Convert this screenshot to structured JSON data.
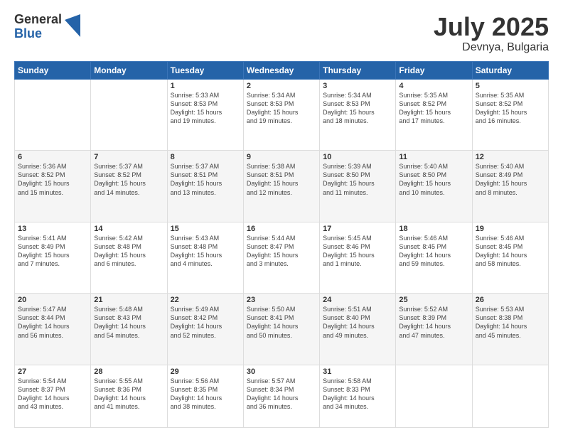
{
  "logo": {
    "general": "General",
    "blue": "Blue"
  },
  "title": "July 2025",
  "location": "Devnya, Bulgaria",
  "weekdays": [
    "Sunday",
    "Monday",
    "Tuesday",
    "Wednesday",
    "Thursday",
    "Friday",
    "Saturday"
  ],
  "weeks": [
    [
      {
        "day": "",
        "info": ""
      },
      {
        "day": "",
        "info": ""
      },
      {
        "day": "1",
        "info": "Sunrise: 5:33 AM\nSunset: 8:53 PM\nDaylight: 15 hours\nand 19 minutes."
      },
      {
        "day": "2",
        "info": "Sunrise: 5:34 AM\nSunset: 8:53 PM\nDaylight: 15 hours\nand 19 minutes."
      },
      {
        "day": "3",
        "info": "Sunrise: 5:34 AM\nSunset: 8:53 PM\nDaylight: 15 hours\nand 18 minutes."
      },
      {
        "day": "4",
        "info": "Sunrise: 5:35 AM\nSunset: 8:52 PM\nDaylight: 15 hours\nand 17 minutes."
      },
      {
        "day": "5",
        "info": "Sunrise: 5:35 AM\nSunset: 8:52 PM\nDaylight: 15 hours\nand 16 minutes."
      }
    ],
    [
      {
        "day": "6",
        "info": "Sunrise: 5:36 AM\nSunset: 8:52 PM\nDaylight: 15 hours\nand 15 minutes."
      },
      {
        "day": "7",
        "info": "Sunrise: 5:37 AM\nSunset: 8:52 PM\nDaylight: 15 hours\nand 14 minutes."
      },
      {
        "day": "8",
        "info": "Sunrise: 5:37 AM\nSunset: 8:51 PM\nDaylight: 15 hours\nand 13 minutes."
      },
      {
        "day": "9",
        "info": "Sunrise: 5:38 AM\nSunset: 8:51 PM\nDaylight: 15 hours\nand 12 minutes."
      },
      {
        "day": "10",
        "info": "Sunrise: 5:39 AM\nSunset: 8:50 PM\nDaylight: 15 hours\nand 11 minutes."
      },
      {
        "day": "11",
        "info": "Sunrise: 5:40 AM\nSunset: 8:50 PM\nDaylight: 15 hours\nand 10 minutes."
      },
      {
        "day": "12",
        "info": "Sunrise: 5:40 AM\nSunset: 8:49 PM\nDaylight: 15 hours\nand 8 minutes."
      }
    ],
    [
      {
        "day": "13",
        "info": "Sunrise: 5:41 AM\nSunset: 8:49 PM\nDaylight: 15 hours\nand 7 minutes."
      },
      {
        "day": "14",
        "info": "Sunrise: 5:42 AM\nSunset: 8:48 PM\nDaylight: 15 hours\nand 6 minutes."
      },
      {
        "day": "15",
        "info": "Sunrise: 5:43 AM\nSunset: 8:48 PM\nDaylight: 15 hours\nand 4 minutes."
      },
      {
        "day": "16",
        "info": "Sunrise: 5:44 AM\nSunset: 8:47 PM\nDaylight: 15 hours\nand 3 minutes."
      },
      {
        "day": "17",
        "info": "Sunrise: 5:45 AM\nSunset: 8:46 PM\nDaylight: 15 hours\nand 1 minute."
      },
      {
        "day": "18",
        "info": "Sunrise: 5:46 AM\nSunset: 8:45 PM\nDaylight: 14 hours\nand 59 minutes."
      },
      {
        "day": "19",
        "info": "Sunrise: 5:46 AM\nSunset: 8:45 PM\nDaylight: 14 hours\nand 58 minutes."
      }
    ],
    [
      {
        "day": "20",
        "info": "Sunrise: 5:47 AM\nSunset: 8:44 PM\nDaylight: 14 hours\nand 56 minutes."
      },
      {
        "day": "21",
        "info": "Sunrise: 5:48 AM\nSunset: 8:43 PM\nDaylight: 14 hours\nand 54 minutes."
      },
      {
        "day": "22",
        "info": "Sunrise: 5:49 AM\nSunset: 8:42 PM\nDaylight: 14 hours\nand 52 minutes."
      },
      {
        "day": "23",
        "info": "Sunrise: 5:50 AM\nSunset: 8:41 PM\nDaylight: 14 hours\nand 50 minutes."
      },
      {
        "day": "24",
        "info": "Sunrise: 5:51 AM\nSunset: 8:40 PM\nDaylight: 14 hours\nand 49 minutes."
      },
      {
        "day": "25",
        "info": "Sunrise: 5:52 AM\nSunset: 8:39 PM\nDaylight: 14 hours\nand 47 minutes."
      },
      {
        "day": "26",
        "info": "Sunrise: 5:53 AM\nSunset: 8:38 PM\nDaylight: 14 hours\nand 45 minutes."
      }
    ],
    [
      {
        "day": "27",
        "info": "Sunrise: 5:54 AM\nSunset: 8:37 PM\nDaylight: 14 hours\nand 43 minutes."
      },
      {
        "day": "28",
        "info": "Sunrise: 5:55 AM\nSunset: 8:36 PM\nDaylight: 14 hours\nand 41 minutes."
      },
      {
        "day": "29",
        "info": "Sunrise: 5:56 AM\nSunset: 8:35 PM\nDaylight: 14 hours\nand 38 minutes."
      },
      {
        "day": "30",
        "info": "Sunrise: 5:57 AM\nSunset: 8:34 PM\nDaylight: 14 hours\nand 36 minutes."
      },
      {
        "day": "31",
        "info": "Sunrise: 5:58 AM\nSunset: 8:33 PM\nDaylight: 14 hours\nand 34 minutes."
      },
      {
        "day": "",
        "info": ""
      },
      {
        "day": "",
        "info": ""
      }
    ]
  ]
}
